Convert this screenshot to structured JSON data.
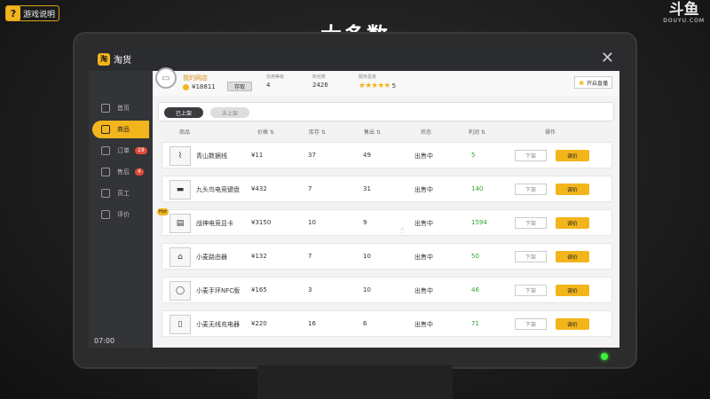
{
  "overlay": {
    "help_label": "游戏说明",
    "caption": "大多数",
    "watermark_big": "斗鱼",
    "watermark_small": "DOUYU.COM"
  },
  "app": {
    "title": "淘货",
    "close_glyph": "✕"
  },
  "sidebar": {
    "items": [
      {
        "label": "首页",
        "icon": "home-icon",
        "badge": ""
      },
      {
        "label": "商品",
        "icon": "bag-icon",
        "badge": "",
        "active": true
      },
      {
        "label": "订单",
        "icon": "order-icon",
        "badge": "19"
      },
      {
        "label": "售后",
        "icon": "aftersale-icon",
        "badge": "4"
      },
      {
        "label": "员工",
        "icon": "staff-icon",
        "badge": ""
      },
      {
        "label": "评价",
        "icon": "thumb-icon",
        "badge": ""
      }
    ],
    "clock": "07:00"
  },
  "shop": {
    "name": "我的网店",
    "money": "¥18811",
    "save_label": "存取",
    "level_label": "信用等级",
    "level_value": "4",
    "fans_label": "粉丝数",
    "fans_value": "2426",
    "rating_label": "服务星级",
    "rating_stars": "★★★★★",
    "rating_value": "5",
    "live_label": "开启直播"
  },
  "tabs": {
    "listed": "已上架",
    "unlisted": "未上架"
  },
  "columns": {
    "product": "商品",
    "price": "价格 ⇅",
    "stock": "库存 ⇅",
    "sold": "售出 ⇅",
    "status": "状态",
    "profit": "利润 ⇅",
    "action": "操作"
  },
  "products": [
    {
      "name": "青山数据线",
      "price": "¥11",
      "stock": "37",
      "sold": "49",
      "status": "出售中",
      "profit": "5",
      "hot": ""
    },
    {
      "name": "九头鸟电竞键盘",
      "price": "¥432",
      "stock": "7",
      "sold": "31",
      "status": "出售中",
      "profit": "140",
      "hot": ""
    },
    {
      "name": "战神电竞显卡",
      "price": "¥3150",
      "stock": "10",
      "sold": "9",
      "status": "出售中",
      "profit": "1594",
      "hot": "Hot"
    },
    {
      "name": "小麦路由器",
      "price": "¥132",
      "stock": "7",
      "sold": "10",
      "status": "出售中",
      "profit": "50",
      "hot": ""
    },
    {
      "name": "小麦手环NFC版",
      "price": "¥165",
      "stock": "3",
      "sold": "10",
      "status": "出售中",
      "profit": "46",
      "hot": ""
    },
    {
      "name": "小麦无线充电器",
      "price": "¥220",
      "stock": "16",
      "sold": "6",
      "status": "出售中",
      "profit": "71",
      "hot": ""
    }
  ],
  "row_actions": {
    "unlist": "下架",
    "price": "调价"
  },
  "colors": {
    "accent": "#f2b51c",
    "profit": "#2aa52a",
    "badge": "#e04a3a"
  }
}
